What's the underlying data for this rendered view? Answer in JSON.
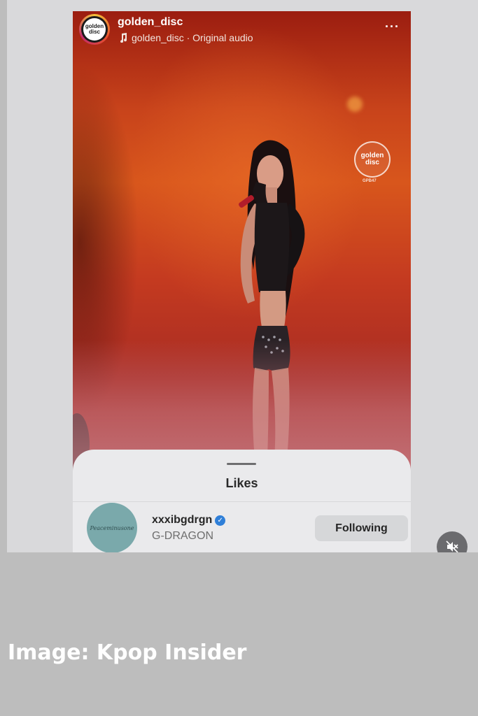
{
  "post": {
    "username": "golden_disc",
    "audio_label": "golden_disc · Original audio",
    "avatar_logo_text": [
      "golden",
      "disc"
    ],
    "watermark_text": [
      "golden",
      "disc"
    ],
    "watermark_sub": "GPB47",
    "more_icon": "more-horizontal-icon",
    "music_icon": "music-note-icon"
  },
  "likes_sheet": {
    "title": "Likes",
    "user": {
      "username": "xxxibgdrgn",
      "full_name": "G-DRAGON",
      "verified": true,
      "avatar_text": "Peaceminusone",
      "button_label": "Following"
    }
  },
  "controls": {
    "mute_icon": "speaker-muted-icon"
  },
  "credit": "Image: Kpop Insider",
  "colors": {
    "background": "#bdbdbd",
    "panel": "#d9d9db",
    "sheet": "#eaeaec",
    "verified_blue": "#2f7fd8",
    "button_gray": "#d6d7d9"
  }
}
